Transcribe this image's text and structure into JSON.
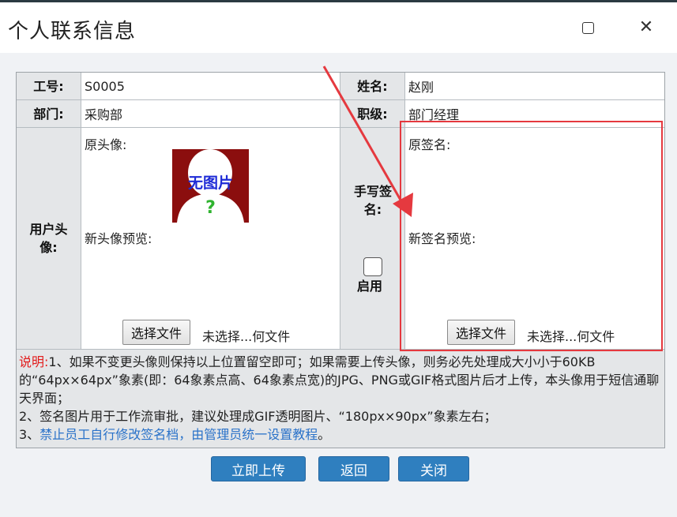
{
  "window": {
    "title": "个人联系信息",
    "maximize_icon": "maximize-icon",
    "close_icon": "close-icon"
  },
  "form": {
    "employee_id_label": "工号:",
    "employee_id_value": "S0005",
    "name_label": "姓名:",
    "name_value": "赵刚",
    "department_label": "部门:",
    "department_value": "采购部",
    "rank_label": "职级:",
    "rank_value": "部门经理",
    "avatar_label": "用户头像:",
    "original_avatar_caption": "原头像:",
    "avatar_placeholder_text": "无图片",
    "avatar_placeholder_mark": "?",
    "new_avatar_preview_caption": "新头像预览:",
    "signature_label": "手写签名:",
    "enable_label": "启用",
    "original_signature_caption": "原签名:",
    "new_signature_preview_caption": "新签名预览:",
    "choose_file_label": "选择文件",
    "no_file_text": "未选择...何文件"
  },
  "notes": {
    "prefix": "说明:",
    "line1": "1、如果不变更头像则保持以上位置留空即可；如果需要上传头像，则务必先处理成大小小于60KB的“64px×64px”象素(即：64象素点高、64象素点宽)的JPG、PNG或GIF格式图片后才上传，本头像用于短信通聊天界面；",
    "line2": "2、签名图片用于工作流审批，建议处理成GIF透明图片、“180px×90px”象素左右；",
    "line3_prefix": "3、",
    "line3_link": "禁止员工自行修改签名档，由管理员统一设置教程",
    "line3_suffix": "。"
  },
  "actions": {
    "upload_label": "立即上传",
    "back_label": "返回",
    "close_label": "关闭"
  },
  "colors": {
    "accent_button": "#2f7fbf",
    "annotation_red": "#e5393f",
    "note_prefix_red": "#e21c1c",
    "link_blue": "#2a72c9",
    "label_bg": "#e4e6e8"
  }
}
